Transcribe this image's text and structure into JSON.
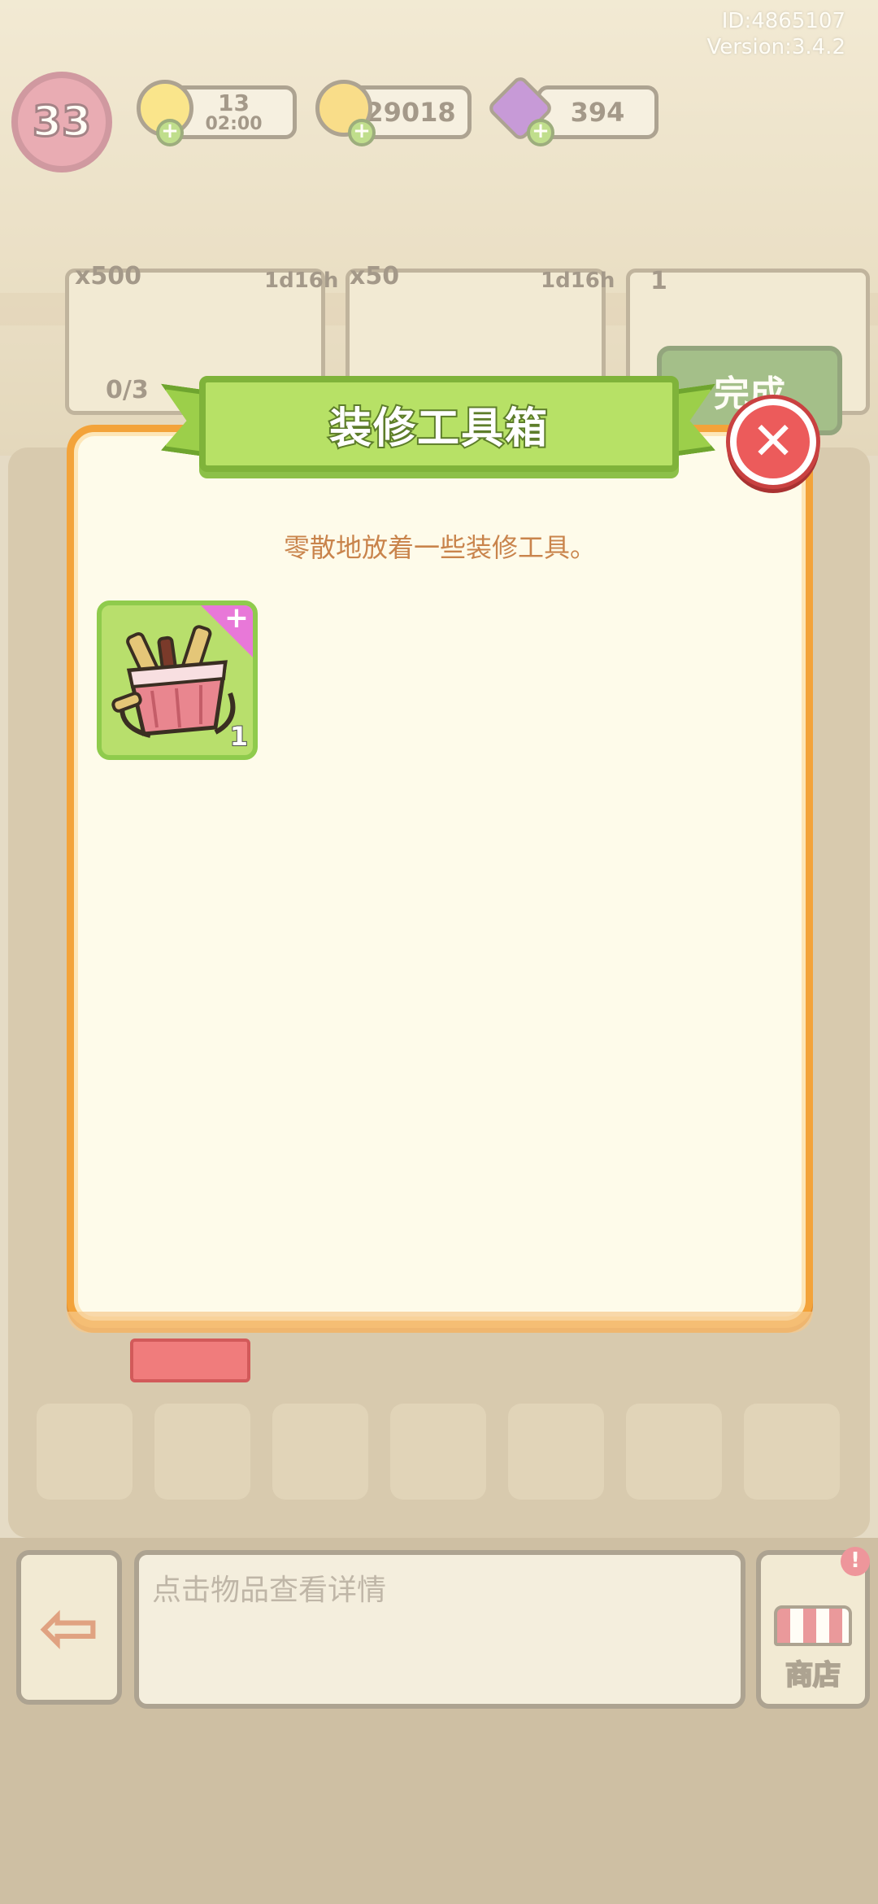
{
  "meta": {
    "id_label": "ID:4865107",
    "version_label": "Version:3.4.2"
  },
  "hud": {
    "level": "33",
    "energy": "13",
    "energy_timer": "02:00",
    "coins": "29018",
    "gems": "394"
  },
  "orders": [
    {
      "reward": "x500",
      "timer": "1d16h",
      "progress": "0/3"
    },
    {
      "reward": "x50",
      "timer": "1d16h"
    },
    {
      "reward": "1"
    }
  ],
  "background": {
    "done_label": "完成"
  },
  "dialog": {
    "title": "装修工具箱",
    "description": "零散地放着一些装修工具。",
    "item": {
      "name_icon": "toolbox-basket-icon",
      "count": "1"
    }
  },
  "bottom_bar": {
    "info_placeholder": "点击物品查看详情",
    "shop_label": "商店"
  },
  "colors": {
    "dialog_border": "#f3a33a",
    "dialog_bg": "#fefbea",
    "title_ribbon": "#b7e166",
    "close_button": "#ec5b5b",
    "description_text": "#c9844c",
    "item_slot_bg": "#b8df6c"
  }
}
